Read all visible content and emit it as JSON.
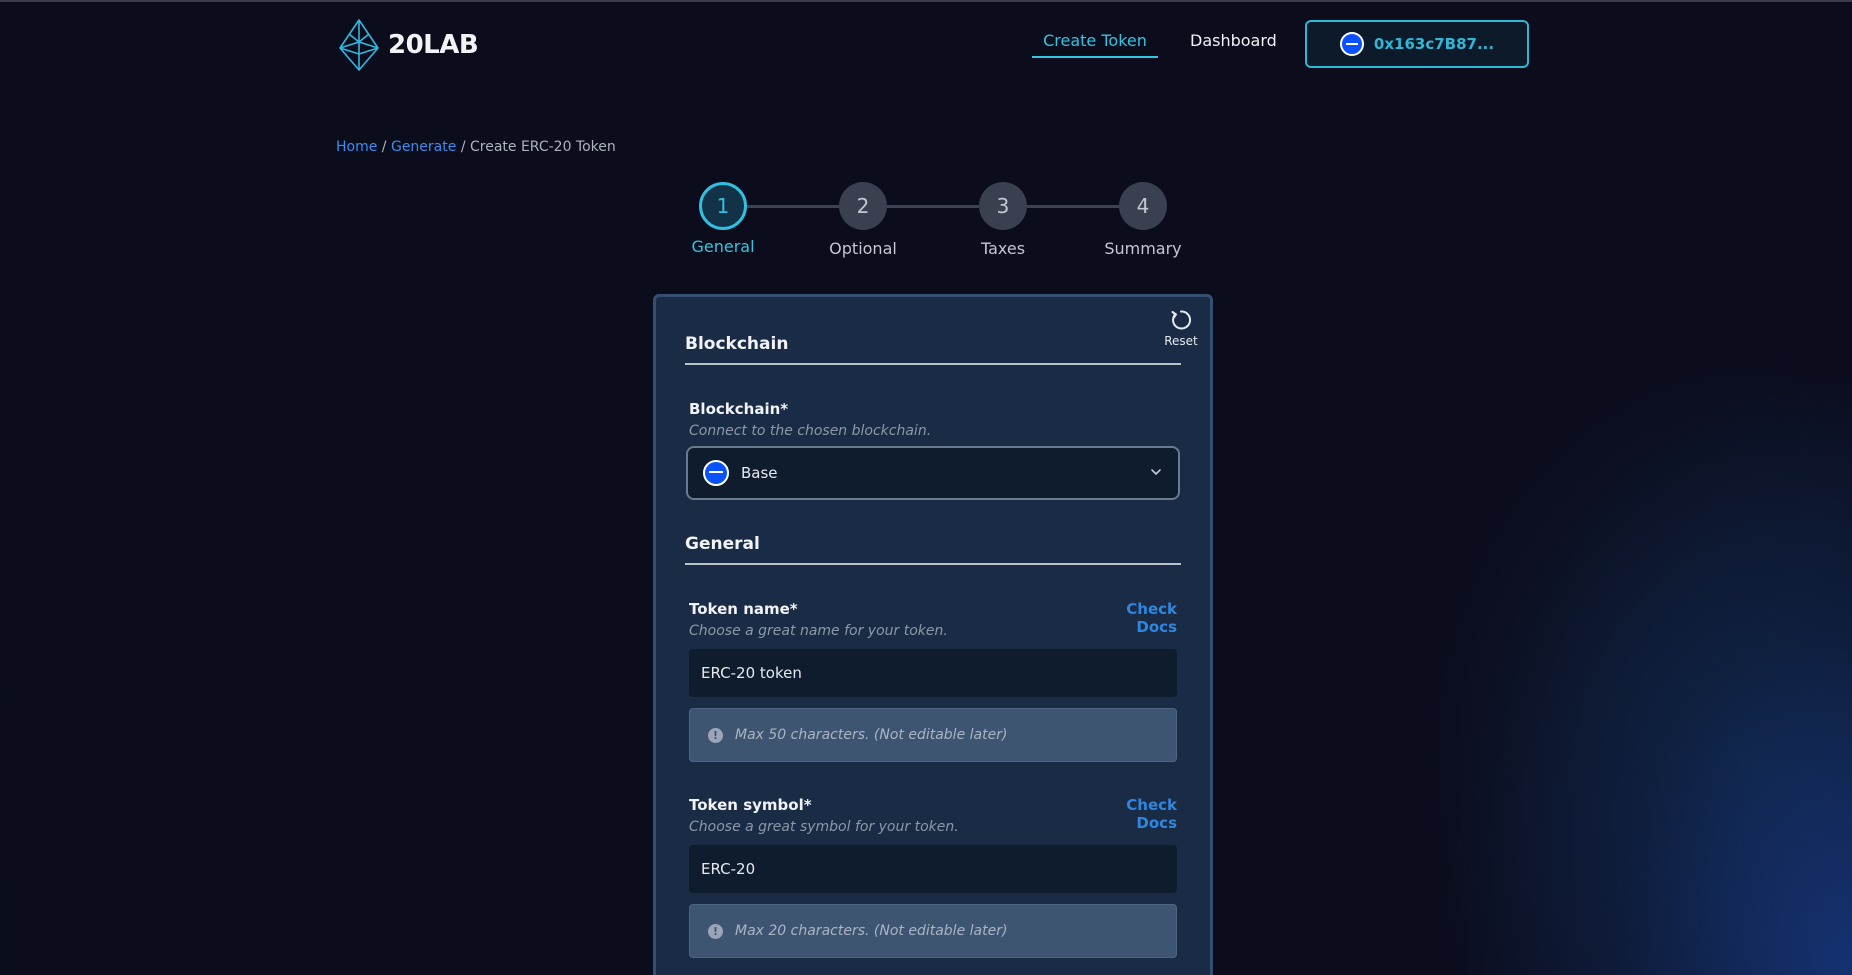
{
  "header": {
    "logo_text": "20LAB",
    "nav": {
      "create_token": "Create Token",
      "dashboard": "Dashboard"
    },
    "wallet": {
      "address": "0x163c7B87...",
      "chain_icon": "base-chain-icon"
    }
  },
  "breadcrumb": {
    "home": "Home",
    "separator": "/",
    "generate": "Generate",
    "current": "Create ERC-20 Token"
  },
  "stepper": {
    "steps": [
      {
        "number": "1",
        "label": "General",
        "active": true
      },
      {
        "number": "2",
        "label": "Optional",
        "active": false
      },
      {
        "number": "3",
        "label": "Taxes",
        "active": false
      },
      {
        "number": "4",
        "label": "Summary",
        "active": false
      }
    ]
  },
  "form": {
    "reset_label": "Reset",
    "blockchain_section": {
      "title": "Blockchain",
      "label": "Blockchain*",
      "hint": "Connect to the chosen blockchain.",
      "selected": "Base"
    },
    "general_section": {
      "title": "General",
      "token_name": {
        "label": "Token name*",
        "hint": "Choose a great name for your token.",
        "value": "ERC-20 token",
        "docs": "Check Docs",
        "note": "Max 50 characters. (Not editable later)"
      },
      "token_symbol": {
        "label": "Token symbol*",
        "hint": "Choose a great symbol for your token.",
        "value": "ERC-20",
        "docs": "Check Docs",
        "note": "Max 20 characters. (Not editable later)"
      }
    }
  },
  "colors": {
    "accent": "#34c4e2",
    "link": "#2f86e0",
    "background": "#0b0c1c",
    "card": "#1a2c45",
    "base_chain": "#0a52ff"
  }
}
